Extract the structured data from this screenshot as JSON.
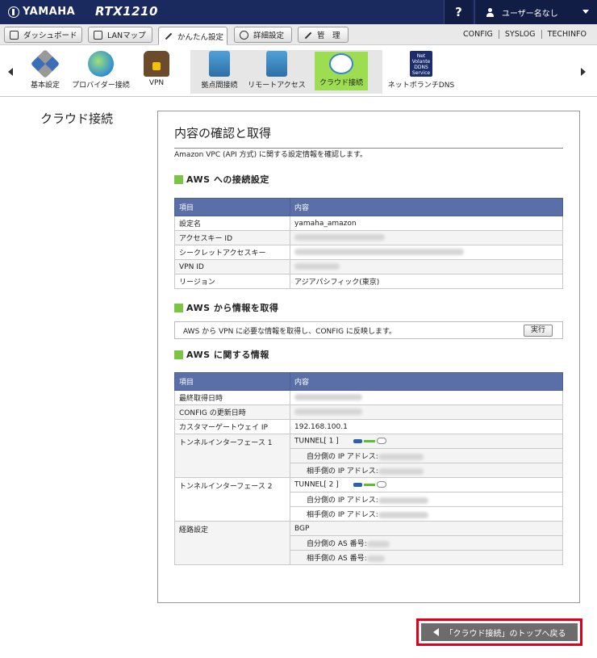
{
  "brand": {
    "maker": "YAMAHA",
    "model": "RTX1210"
  },
  "header": {
    "help": "?",
    "user": "ユーザー名なし"
  },
  "tabs": [
    {
      "label": "ダッシュボード",
      "icon": "dashboard-icon"
    },
    {
      "label": "LANマップ",
      "icon": "lanmap-icon"
    },
    {
      "label": "かんたん設定",
      "icon": "magic-wand-icon"
    },
    {
      "label": "詳細設定",
      "icon": "gear-icon"
    },
    {
      "label": "管　理",
      "icon": "wrench-icon"
    }
  ],
  "toplinks": [
    "CONFIG",
    "SYSLOG",
    "TECHINFO"
  ],
  "menu": [
    {
      "label": "基本設定",
      "icon": "tools-icon"
    },
    {
      "label": "プロバイダー接続",
      "icon": "globe-icon"
    },
    {
      "label": "VPN",
      "icon": "lock-icon"
    },
    {
      "label": "拠点間接続",
      "icon": "site-to-site-icon"
    },
    {
      "label": "リモートアクセス",
      "icon": "remote-access-icon"
    },
    {
      "label": "クラウド接続",
      "icon": "cloud-icon"
    },
    {
      "label": "ネットボランチDNS",
      "icon": "ddns-icon"
    }
  ],
  "ddns_badge": {
    "line1": "Net Volante",
    "line2": "DDNS",
    "line3": "Service"
  },
  "page": {
    "side_title": "クラウド接続",
    "title": "内容の確認と取得",
    "description": "Amazon VPC (API 方式) に関する設定情報を確認します。"
  },
  "section1": {
    "title": "AWS への接続設定",
    "col_item": "項目",
    "col_content": "内容",
    "rows": [
      {
        "key": "設定名",
        "value": "yamaha_amazon"
      },
      {
        "key": "アクセスキー ID",
        "value": ""
      },
      {
        "key": "シークレットアクセスキー",
        "value": ""
      },
      {
        "key": "VPN ID",
        "value": ""
      },
      {
        "key": "リージョン",
        "value": "アジアパシフィック(東京)"
      }
    ]
  },
  "section2": {
    "title": "AWS から情報を取得",
    "text": "AWS から VPN に必要な情報を取得し、CONFIG に反映します。",
    "button": "実行"
  },
  "section3": {
    "title": "AWS に関する情報",
    "col_item": "項目",
    "col_content": "内容",
    "rows": {
      "last_fetch": "最終取得日時",
      "config_update": "CONFIG の更新日時",
      "cgw_ip_key": "カスタマーゲートウェイ IP",
      "cgw_ip": "192.168.100.1",
      "tunnel1_key": "トンネルインターフェース 1",
      "tunnel1": "TUNNEL[ 1 ]",
      "tunnel2_key": "トンネルインターフェース 2",
      "tunnel2": "TUNNEL[ 2 ]",
      "self_ip": "自分側の IP アドレス:",
      "peer_ip": "相手側の IP アドレス:",
      "route_key": "経路設定",
      "route": "BGP",
      "self_as": "自分側の AS 番号:",
      "peer_as": "相手側の AS 番号:"
    }
  },
  "back_button": "「クラウド接続」のトップへ戻る"
}
